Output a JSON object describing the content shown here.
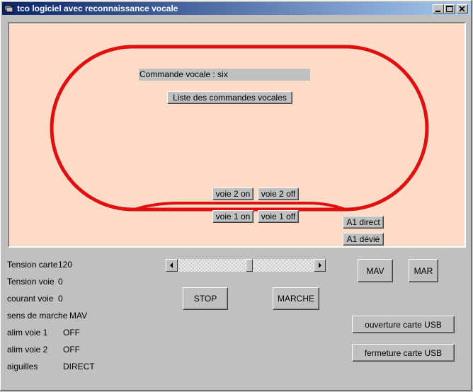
{
  "window": {
    "title": "tco logiciel avec reconnaissance vocale"
  },
  "canvas": {
    "voice_status": "Commande vocale : six",
    "voice_list_button": "Liste des commandes vocales",
    "voie2_on": "voie 2 on",
    "voie2_off": "voie 2 off",
    "voie1_on": "voie 1 on",
    "voie1_off": "voie 1 off",
    "a1_direct": "A1 direct",
    "a1_devie": "A1 dévié",
    "track_color": "#e01010",
    "background_color": "#ffdcc8"
  },
  "info": [
    {
      "label": "Tension carte",
      "value": "120"
    },
    {
      "label": "Tension voie",
      "value": "0"
    },
    {
      "label": "courant voie",
      "value": "0"
    },
    {
      "label": "sens de marche",
      "value": "MAV"
    },
    {
      "label": "alim voie 1",
      "value": "OFF"
    },
    {
      "label": "alim voie 2",
      "value": "OFF"
    },
    {
      "label": "aiguilles",
      "value": "DIRECT"
    }
  ],
  "controls": {
    "stop": "STOP",
    "marche": "MARCHE",
    "mav": "MAV",
    "mar": "MAR",
    "ouverture": "ouverture carte USB",
    "fermeture": "fermeture carte USB",
    "speed_slider_level": 0.53
  }
}
